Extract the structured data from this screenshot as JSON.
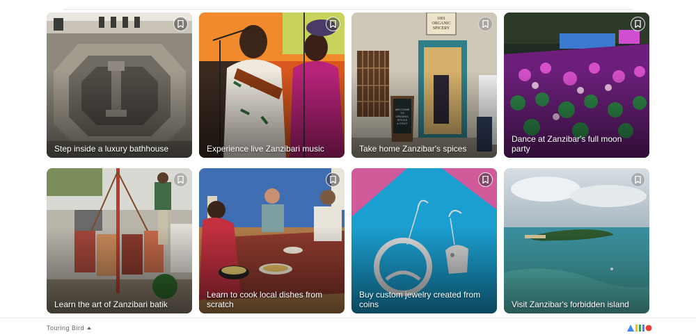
{
  "cards": [
    {
      "caption": "Step inside a luxury bathhouse"
    },
    {
      "caption": "Experience live Zanzibari music"
    },
    {
      "caption": "Take home Zanzibar's spices"
    },
    {
      "caption": "Dance at Zanzibar's full moon party"
    },
    {
      "caption": "Learn the art of Zanzibari batik"
    },
    {
      "caption": "Learn to cook local dishes from scratch"
    },
    {
      "caption": "Buy custom jewelry created from coins"
    },
    {
      "caption": "Visit Zanzibar's forbidden island"
    }
  ],
  "scene_text": {
    "shop_sign_line1": "1001",
    "shop_sign_line2": "ORGANIC",
    "shop_sign_line3": "SPICERY",
    "board_line1": "WELCOME",
    "board_line2": "TO",
    "board_line3": "ORGANIC",
    "board_line4": "SPICES",
    "board_line5": "& FRUIT"
  },
  "footer": {
    "brand": "Touring Bird"
  },
  "icons": {
    "bookmark": "bookmark-icon",
    "caret": "caret-up-icon",
    "logo": "google-logo-icon"
  },
  "colors": {
    "logo_blue": "#4285f4",
    "logo_red": "#ea4335",
    "logo_yellow": "#fbbc05",
    "logo_green": "#34a853"
  }
}
